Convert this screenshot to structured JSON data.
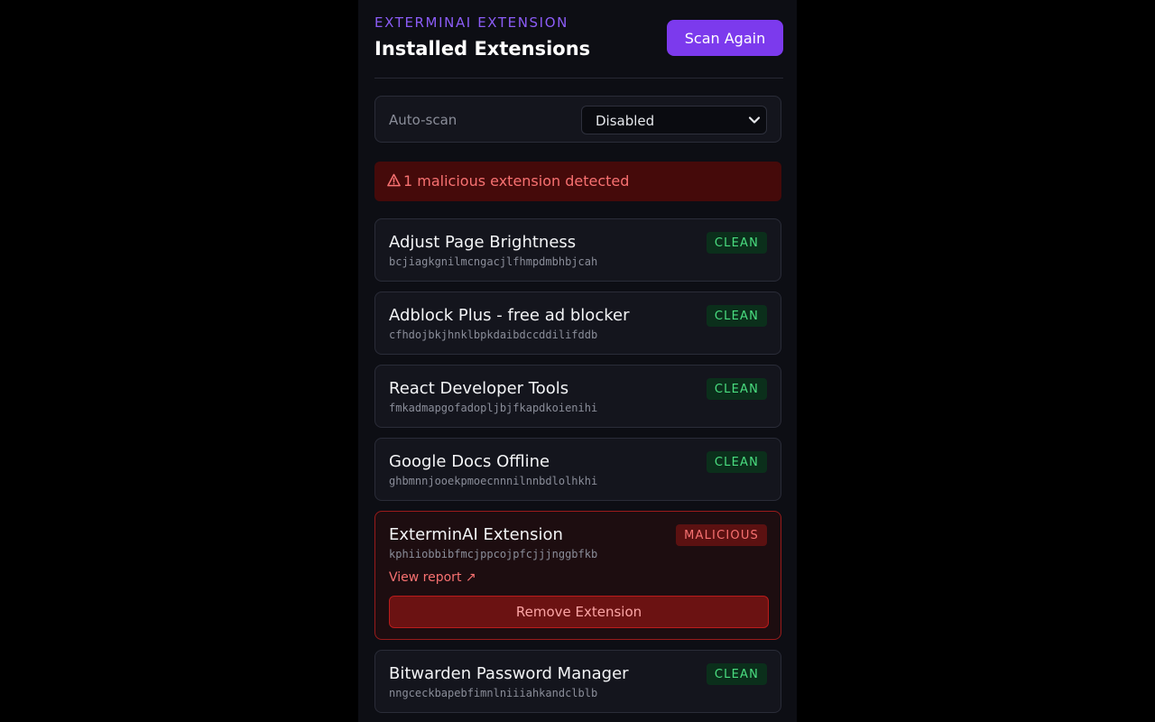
{
  "header": {
    "brand": "EXTERMINAI EXTENSION",
    "title": "Installed Extensions",
    "scan_button": "Scan Again"
  },
  "settings": {
    "autoscan_label": "Auto-scan",
    "autoscan_value": "Disabled"
  },
  "alert": {
    "icon": "warning-icon",
    "text": "1 malicious extension detected"
  },
  "extensions": [
    {
      "name": "Adjust Page Brightness",
      "id": "bcjiagkgnilmcngacjlfhmpdmbhbjcah",
      "status": "CLEAN"
    },
    {
      "name": "Adblock Plus - free ad blocker",
      "id": "cfhdojbkjhnklbpkdaibdccddilifddb",
      "status": "CLEAN"
    },
    {
      "name": "React Developer Tools",
      "id": "fmkadmapgofadopljbjfkapdkoienihi",
      "status": "CLEAN"
    },
    {
      "name": "Google Docs Offline",
      "id": "ghbmnnjooekpmoecnnnilnnbdlolhkhi",
      "status": "CLEAN"
    },
    {
      "name": "ExterminAI Extension",
      "id": "kphiiobbibfmcjppcojpfcjjjnggbfkb",
      "status": "MALICIOUS",
      "report_link": "View report ↗",
      "remove_label": "Remove Extension"
    },
    {
      "name": "Bitwarden Password Manager",
      "id": "nngceckbapebfimnlniiiahkandclblb",
      "status": "CLEAN"
    }
  ],
  "colors": {
    "accent": "#7c3aed",
    "clean": "#4ade80",
    "malicious": "#f87171"
  }
}
